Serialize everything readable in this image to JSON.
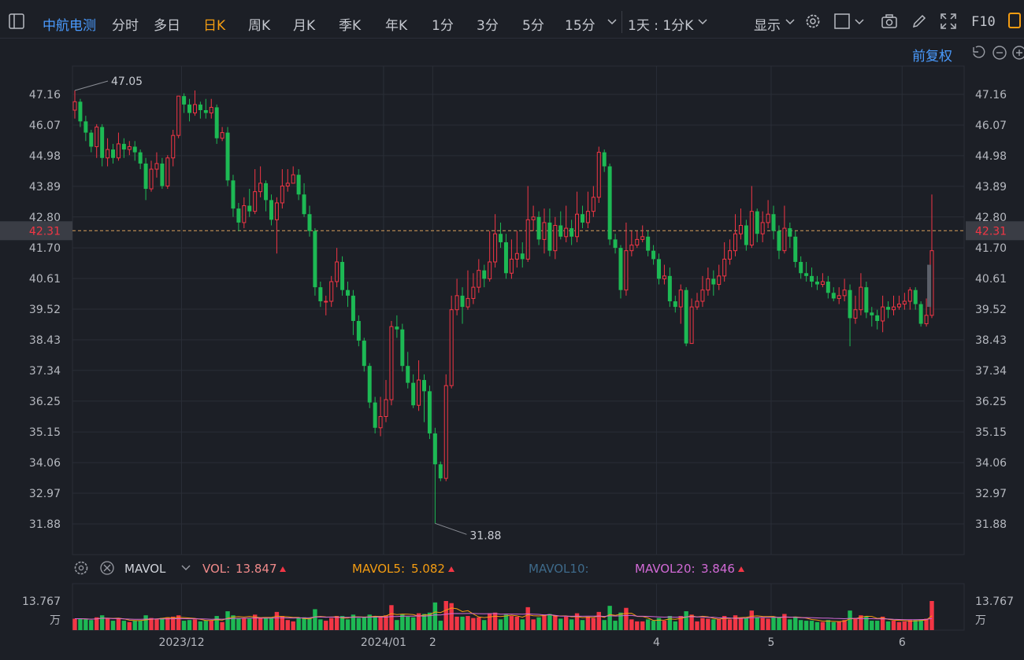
{
  "toolbar": {
    "stock_name": "中航电测",
    "tabs": [
      "分时",
      "多日",
      "日K",
      "周K",
      "月K",
      "季K",
      "年K",
      "1分",
      "3分",
      "5分",
      "15分"
    ],
    "active_tab": "日K",
    "period_select": "1天 : 1分K",
    "display_label": "显示",
    "f10_label": "F10"
  },
  "adjust_label": "前复权",
  "price_axis": {
    "ticks": [
      "47.16",
      "46.07",
      "44.98",
      "43.89",
      "42.80",
      "41.70",
      "40.61",
      "39.52",
      "38.43",
      "37.34",
      "36.25",
      "35.15",
      "34.06",
      "32.97",
      "31.88"
    ],
    "current": "42.31",
    "high_label": "47.05",
    "low_label": "31.88"
  },
  "volume_panel": {
    "indicator": "MAVOL",
    "vol_label": "VOL:",
    "vol_value": "13.847",
    "ma5_label": "MAVOL5:",
    "ma5_value": "5.082",
    "ma10_label": "MAVOL10:",
    "ma20_label": "MAVOL20:",
    "ma20_value": "3.846",
    "axis_max": "13.767",
    "axis_unit": "万"
  },
  "date_axis": [
    "2023/12",
    "2024/01",
    "2",
    "4",
    "5",
    "6"
  ],
  "colors": {
    "up": "#f23645",
    "down": "#1db954",
    "accent": "#f39c12",
    "link": "#4a9bff",
    "ma5": "#f39c12",
    "ma10": "#3e6a8a",
    "ma20": "#d26ad6",
    "grid": "#2a2e37"
  },
  "chart_data": {
    "type": "candlestick",
    "series": [
      {
        "values": [
          [
            46.6,
            46.9,
            47.3,
            46.3
          ],
          [
            46.9,
            46.2,
            47.0,
            46.0
          ],
          [
            46.2,
            45.8,
            46.4,
            45.5
          ],
          [
            45.8,
            45.3,
            45.9,
            45.1
          ],
          [
            45.3,
            46.0,
            46.1,
            44.9
          ],
          [
            46.0,
            44.9,
            46.1,
            44.6
          ],
          [
            44.9,
            45.2,
            45.6,
            44.6
          ],
          [
            45.2,
            44.9,
            45.4,
            44.7
          ],
          [
            44.9,
            45.4,
            45.8,
            44.8
          ],
          [
            45.4,
            45.2,
            45.6,
            44.9
          ],
          [
            45.2,
            45.3,
            45.5,
            45.0
          ],
          [
            45.3,
            45.1,
            45.5,
            44.8
          ],
          [
            45.1,
            44.7,
            45.2,
            44.5
          ],
          [
            44.7,
            43.8,
            44.9,
            43.4
          ],
          [
            43.8,
            44.5,
            44.8,
            43.7
          ],
          [
            44.5,
            44.7,
            45.1,
            44.2
          ],
          [
            44.7,
            43.9,
            44.9,
            43.8
          ],
          [
            43.9,
            44.9,
            45.0,
            43.8
          ],
          [
            44.9,
            45.7,
            45.9,
            44.6
          ],
          [
            45.7,
            47.1,
            47.1,
            45.6
          ],
          [
            47.1,
            46.8,
            47.2,
            46.5
          ],
          [
            46.8,
            46.5,
            47.0,
            46.2
          ],
          [
            46.5,
            46.8,
            47.3,
            46.4
          ],
          [
            46.8,
            46.6,
            46.9,
            46.3
          ],
          [
            46.6,
            46.5,
            47.0,
            46.3
          ],
          [
            46.5,
            46.7,
            47.0,
            46.3
          ],
          [
            46.7,
            45.6,
            46.8,
            45.4
          ],
          [
            45.6,
            45.8,
            46.0,
            45.5
          ],
          [
            45.8,
            44.1,
            46.0,
            43.9
          ],
          [
            44.1,
            43.1,
            44.3,
            42.8
          ],
          [
            43.1,
            42.6,
            43.3,
            42.3
          ],
          [
            42.6,
            43.2,
            43.5,
            42.4
          ],
          [
            43.2,
            43.0,
            43.8,
            42.8
          ],
          [
            43.0,
            43.7,
            44.5,
            42.9
          ],
          [
            43.7,
            44.0,
            44.6,
            43.5
          ],
          [
            44.0,
            43.4,
            44.1,
            43.0
          ],
          [
            43.4,
            42.7,
            43.6,
            42.5
          ],
          [
            42.7,
            43.3,
            43.5,
            41.5
          ],
          [
            43.3,
            43.9,
            44.5,
            43.1
          ],
          [
            43.9,
            44.0,
            44.5,
            43.7
          ],
          [
            44.0,
            44.3,
            44.6,
            44.0
          ],
          [
            44.3,
            43.6,
            44.5,
            43.4
          ],
          [
            43.6,
            42.9,
            44.0,
            42.8
          ],
          [
            42.9,
            42.3,
            43.2,
            42.1
          ],
          [
            42.3,
            40.3,
            42.4,
            40.0
          ],
          [
            40.3,
            39.8,
            40.5,
            39.6
          ],
          [
            39.8,
            39.8,
            40.0,
            39.3
          ],
          [
            39.8,
            40.5,
            40.7,
            39.6
          ],
          [
            40.5,
            41.2,
            41.7,
            40.3
          ],
          [
            41.2,
            40.2,
            41.4,
            40.0
          ],
          [
            40.2,
            40.0,
            40.5,
            39.6
          ],
          [
            40.0,
            39.1,
            40.2,
            38.6
          ],
          [
            39.1,
            38.4,
            39.3,
            38.2
          ],
          [
            38.4,
            37.5,
            38.5,
            37.3
          ],
          [
            37.5,
            36.2,
            37.6,
            36.0
          ],
          [
            36.2,
            35.3,
            36.4,
            35.1
          ],
          [
            35.3,
            35.7,
            36.4,
            35.0
          ],
          [
            35.7,
            36.3,
            37.0,
            35.5
          ],
          [
            36.3,
            38.9,
            39.1,
            36.1
          ],
          [
            38.9,
            38.8,
            39.3,
            38.5
          ],
          [
            38.8,
            37.5,
            39.0,
            37.3
          ],
          [
            37.5,
            36.9,
            38.0,
            36.7
          ],
          [
            36.9,
            36.1,
            37.2,
            36.0
          ],
          [
            36.1,
            37.0,
            37.7,
            35.9
          ],
          [
            37.0,
            36.6,
            37.2,
            35.5
          ],
          [
            36.6,
            35.1,
            36.8,
            34.9
          ],
          [
            35.1,
            34.0,
            35.3,
            31.9
          ],
          [
            34.0,
            33.5,
            34.1,
            33.4
          ],
          [
            33.5,
            36.8,
            37.2,
            33.4
          ],
          [
            36.8,
            39.5,
            40.0,
            36.7
          ],
          [
            39.5,
            40.0,
            40.6,
            39.3
          ],
          [
            40.0,
            39.6,
            40.3,
            39.0
          ],
          [
            39.6,
            39.9,
            40.9,
            39.5
          ],
          [
            39.9,
            40.3,
            40.8,
            39.7
          ],
          [
            40.3,
            40.9,
            41.3,
            40.1
          ],
          [
            40.9,
            40.6,
            41.1,
            40.3
          ],
          [
            40.6,
            41.2,
            42.3,
            40.5
          ],
          [
            41.2,
            42.2,
            42.9,
            41.0
          ],
          [
            42.2,
            41.9,
            42.6,
            41.7
          ],
          [
            41.9,
            40.8,
            42.2,
            40.6
          ],
          [
            40.8,
            41.3,
            42.0,
            40.6
          ],
          [
            41.3,
            41.5,
            42.3,
            41.0
          ],
          [
            41.5,
            41.3,
            41.9,
            41.0
          ],
          [
            41.3,
            42.7,
            43.9,
            41.2
          ],
          [
            42.7,
            42.8,
            43.2,
            42.3
          ],
          [
            42.8,
            42.0,
            43.0,
            41.8
          ],
          [
            42.0,
            42.6,
            43.1,
            41.5
          ],
          [
            42.6,
            41.6,
            43.1,
            41.4
          ],
          [
            41.6,
            42.5,
            42.8,
            41.3
          ],
          [
            42.5,
            42.1,
            43.0,
            42.0
          ],
          [
            42.1,
            42.4,
            43.2,
            41.9
          ],
          [
            42.4,
            42.1,
            42.7,
            41.8
          ],
          [
            42.1,
            42.9,
            43.7,
            41.9
          ],
          [
            42.9,
            42.6,
            43.2,
            42.4
          ],
          [
            42.6,
            43.0,
            43.7,
            42.4
          ],
          [
            43.0,
            43.5,
            43.9,
            42.8
          ],
          [
            43.5,
            45.1,
            45.3,
            43.3
          ],
          [
            45.1,
            44.6,
            45.2,
            44.4
          ],
          [
            44.6,
            42.0,
            44.7,
            41.8
          ],
          [
            42.0,
            41.7,
            42.2,
            41.5
          ],
          [
            41.7,
            40.2,
            41.8,
            39.9
          ],
          [
            40.2,
            41.6,
            42.6,
            40.0
          ],
          [
            41.6,
            41.8,
            42.3,
            41.4
          ],
          [
            41.8,
            42.0,
            42.3,
            41.7
          ],
          [
            42.0,
            42.1,
            42.5,
            41.9
          ],
          [
            42.1,
            41.6,
            42.3,
            41.4
          ],
          [
            41.6,
            41.3,
            41.8,
            41.1
          ],
          [
            41.3,
            40.6,
            41.5,
            40.4
          ],
          [
            40.6,
            40.7,
            41.1,
            40.4
          ],
          [
            40.7,
            39.8,
            41.0,
            39.6
          ],
          [
            39.8,
            39.6,
            40.0,
            39.4
          ],
          [
            39.6,
            40.2,
            40.4,
            39.0
          ],
          [
            40.2,
            38.3,
            40.3,
            38.2
          ],
          [
            38.3,
            39.6,
            39.9,
            38.3
          ],
          [
            39.6,
            39.8,
            40.1,
            39.5
          ],
          [
            39.8,
            40.2,
            40.7,
            39.6
          ],
          [
            40.2,
            40.6,
            41.0,
            40.0
          ],
          [
            40.6,
            40.4,
            40.9,
            40.0
          ],
          [
            40.4,
            40.7,
            41.1,
            40.2
          ],
          [
            40.7,
            41.3,
            41.9,
            40.5
          ],
          [
            41.3,
            41.6,
            42.0,
            41.1
          ],
          [
            41.6,
            42.2,
            42.9,
            41.4
          ],
          [
            42.2,
            42.5,
            43.1,
            42.0
          ],
          [
            42.5,
            41.8,
            42.7,
            41.6
          ],
          [
            41.8,
            43.0,
            43.9,
            41.7
          ],
          [
            43.0,
            42.2,
            43.1,
            41.9
          ],
          [
            42.2,
            42.6,
            43.0,
            41.9
          ],
          [
            42.6,
            42.9,
            43.4,
            42.4
          ],
          [
            42.9,
            42.3,
            43.2,
            42.0
          ],
          [
            42.3,
            41.6,
            42.5,
            41.3
          ],
          [
            41.6,
            42.4,
            43.2,
            41.5
          ],
          [
            42.4,
            42.1,
            42.6,
            41.7
          ],
          [
            42.1,
            41.2,
            42.3,
            41.0
          ],
          [
            41.2,
            40.8,
            41.4,
            40.6
          ],
          [
            40.8,
            40.7,
            41.2,
            40.5
          ],
          [
            40.7,
            40.5,
            41.0,
            40.3
          ],
          [
            40.5,
            40.4,
            40.7,
            40.2
          ],
          [
            40.4,
            40.5,
            40.8,
            40.3
          ],
          [
            40.5,
            40.1,
            40.7,
            39.9
          ],
          [
            40.1,
            39.9,
            40.3,
            39.8
          ],
          [
            39.9,
            40.0,
            40.3,
            39.7
          ],
          [
            40.0,
            40.2,
            40.6,
            39.8
          ],
          [
            40.2,
            39.2,
            40.4,
            38.2
          ],
          [
            39.2,
            39.5,
            40.0,
            39.0
          ],
          [
            39.5,
            40.3,
            40.8,
            39.3
          ],
          [
            40.3,
            39.4,
            40.5,
            39.2
          ],
          [
            39.4,
            39.3,
            39.6,
            38.9
          ],
          [
            39.3,
            39.1,
            39.5,
            38.8
          ],
          [
            39.1,
            39.6,
            40.0,
            38.7
          ],
          [
            39.6,
            39.5,
            39.8,
            39.2
          ],
          [
            39.5,
            39.6,
            40.0,
            39.3
          ],
          [
            39.6,
            39.7,
            40.0,
            39.5
          ],
          [
            39.7,
            39.8,
            40.1,
            39.5
          ],
          [
            39.8,
            40.2,
            40.3,
            39.5
          ],
          [
            40.2,
            39.7,
            40.3,
            39.5
          ],
          [
            39.7,
            39.0,
            39.8,
            38.9
          ],
          [
            39.0,
            39.3,
            39.9,
            38.9
          ],
          [
            39.3,
            41.6,
            43.6,
            39.2
          ]
        ]
      }
    ],
    "ylim": [
      31.88,
      47.16
    ],
    "volume_ylim": [
      0,
      13.767
    ]
  }
}
